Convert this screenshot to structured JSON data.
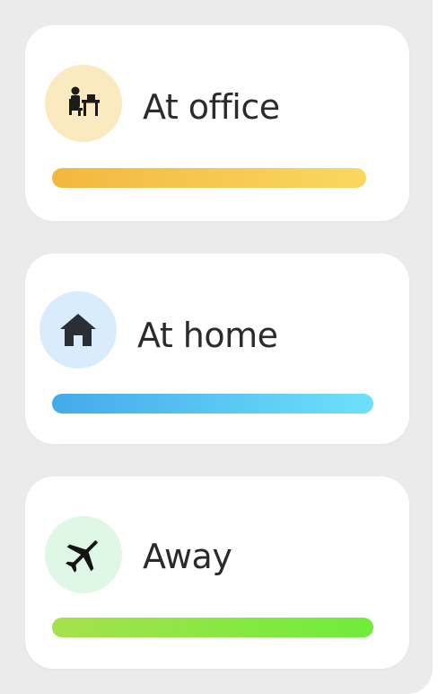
{
  "statuses": [
    {
      "label": "At office",
      "icon": "desk-worker-icon",
      "icon_bg": "#fbe9bf",
      "bar_start": "#f3b73f",
      "bar_end": "#f9d860",
      "progress": 1.0
    },
    {
      "label": "At home",
      "icon": "home-icon",
      "icon_bg": "#d9ecfd",
      "bar_start": "#44aaea",
      "bar_end": "#6ee0fb",
      "progress": 1.0
    },
    {
      "label": "Away",
      "icon": "airplane-icon",
      "icon_bg": "#dff8e6",
      "bar_start": "#a6e14c",
      "bar_end": "#6fec3b",
      "progress": 1.0
    }
  ]
}
